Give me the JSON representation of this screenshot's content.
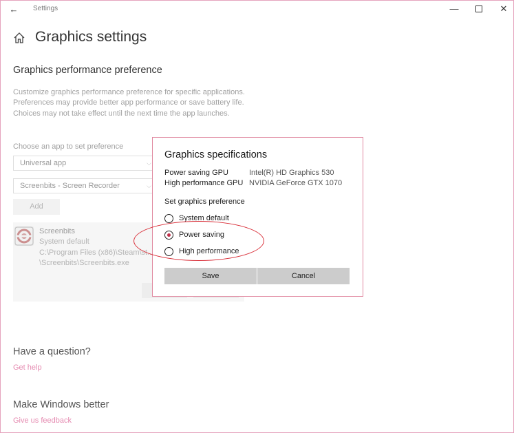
{
  "window": {
    "title": "Settings",
    "back_icon": "back-arrow-icon",
    "minimize_glyph": "—",
    "close_glyph": "✕"
  },
  "page": {
    "title": "Graphics settings",
    "section_title": "Graphics performance preference",
    "description": "Customize graphics performance preference for specific applications. Preferences may provide better app performance or save battery life. Choices may not take effect until the next time the app launches.",
    "choose_label": "Choose an app to set preference",
    "app_type_dropdown": "Universal app",
    "app_dropdown": "Screenbits - Screen Recorder",
    "add_label": "Add"
  },
  "app_card": {
    "name": "Screenbits",
    "preference": "System default",
    "path": "C:\\Program Files (x86)\\Steam\\st... \\Screenbits\\Screenbits.exe"
  },
  "footer": {
    "question_title": "Have a question?",
    "get_help": "Get help",
    "improve_title": "Make Windows better",
    "feedback": "Give us feedback"
  },
  "dialog": {
    "title": "Graphics specifications",
    "specs": [
      {
        "label": "Power saving GPU",
        "value": "Intel(R) HD Graphics 530"
      },
      {
        "label": "High performance GPU",
        "value": "NVIDIA GeForce GTX 1070"
      }
    ],
    "pref_label": "Set graphics preference",
    "options": [
      {
        "label": "System default",
        "selected": false
      },
      {
        "label": "Power saving",
        "selected": true
      },
      {
        "label": "High performance",
        "selected": false
      }
    ],
    "save_label": "Save",
    "cancel_label": "Cancel"
  },
  "colors": {
    "accent_link": "#e58ab0",
    "dialog_border": "#e0879f",
    "annotation": "#d9303a"
  }
}
